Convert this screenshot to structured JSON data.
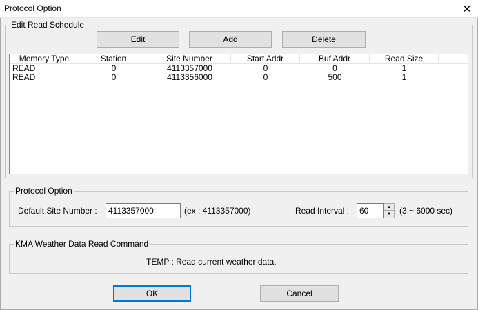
{
  "window": {
    "title": "Protocol Option"
  },
  "schedule": {
    "group_label": "Edit Read Schedule",
    "buttons": {
      "edit": "Edit",
      "add": "Add",
      "delete": "Delete"
    },
    "columns": [
      "Memory Type",
      "Station",
      "Site Number",
      "Start Addr",
      "Buf Addr",
      "Read Size"
    ],
    "rows": [
      [
        "READ",
        "0",
        "4113357000",
        "0",
        "0",
        "1"
      ],
      [
        "READ",
        "0",
        "4113356000",
        "0",
        "500",
        "1"
      ]
    ]
  },
  "protocol": {
    "group_label": "Protocol Option",
    "site_label": "Default Site Number :",
    "site_value": "4113357000",
    "site_example": "(ex : 4113357000)",
    "interval_label": "Read Interval :",
    "interval_value": "60",
    "interval_range": "(3 ~ 6000 sec)"
  },
  "kma": {
    "group_label": "KMA Weather Data Read Command",
    "command_text": "TEMP : Read current weather data,"
  },
  "footer": {
    "ok": "OK",
    "cancel": "Cancel"
  }
}
